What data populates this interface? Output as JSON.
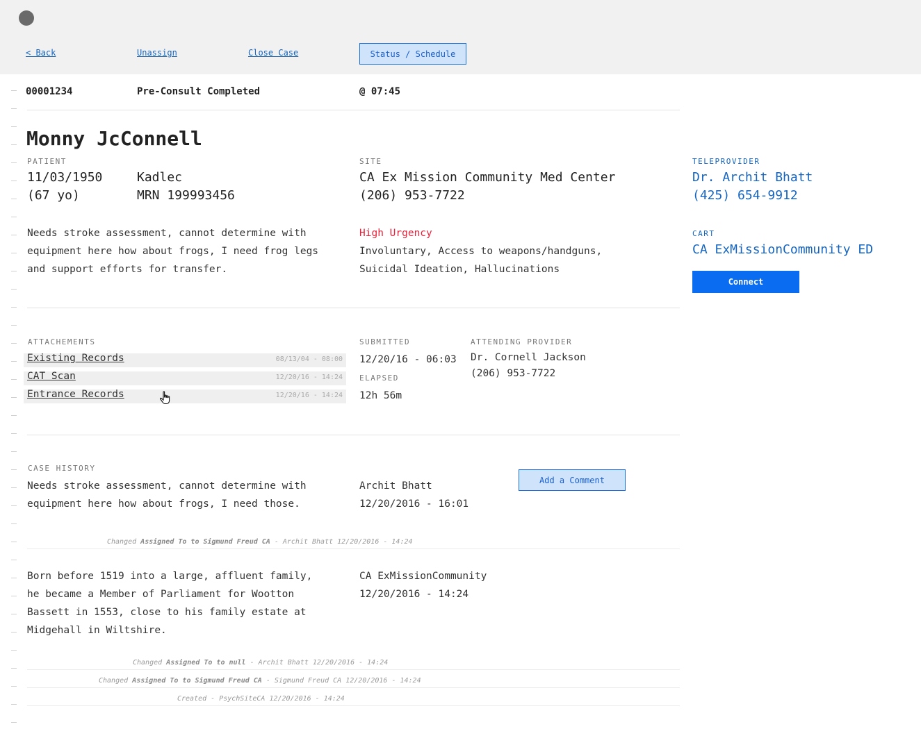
{
  "nav": {
    "back": "< Back",
    "unassign": "Unassign",
    "close_case": "Close Case",
    "status_schedule": "Status / Schedule"
  },
  "case": {
    "id": "00001234",
    "status": "Pre-Consult Completed",
    "time": "@ 07:45"
  },
  "patient": {
    "name": "Monny JcConnell",
    "label": "PATIENT",
    "dob": "11/03/1950",
    "age": "(67 yo)",
    "facility": "Kadlec",
    "mrn": "MRN 199993456",
    "note": "Needs stroke assessment, cannot determine with equipment here how about frogs, I need frog legs and support efforts for transfer."
  },
  "site": {
    "label": "SITE",
    "name": "CA Ex Mission Community Med Center",
    "phone": "(206) 953-7722",
    "urgency": "High Urgency",
    "urgency_color": "#e8223a",
    "flags": "Involuntary, Access to weapons/handguns, Suicidal Ideation, Hallucinations"
  },
  "teleprovider": {
    "label": "TELEPROVIDER",
    "name": "Dr. Archit Bhatt",
    "phone": "(425) 654-9912"
  },
  "cart": {
    "label": "CART",
    "name": "CA ExMissionCommunity ED",
    "connect": "Connect"
  },
  "attachments": {
    "label": "ATTACHEMENTS",
    "items": [
      {
        "name": "Existing Records",
        "date": "08/13/04 - 08:00"
      },
      {
        "name": "CAT Scan",
        "date": "12/20/16 - 14:24"
      },
      {
        "name": "Entrance Records",
        "date": "12/20/16 - 14:24"
      }
    ]
  },
  "submitted": {
    "label": "SUBMITTED",
    "value": "12/20/16 - 06:03",
    "elapsed_label": "ELAPSED",
    "elapsed": "12h 56m"
  },
  "attending": {
    "label": "ATTENDING PROVIDER",
    "name": "Dr. Cornell Jackson",
    "phone": "(206) 953-7722"
  },
  "history": {
    "label": "CASE HISTORY",
    "add_comment": "Add a Comment",
    "comments": [
      {
        "text": "Needs stroke assessment, cannot determine with equipment here how about frogs, I need those.",
        "author": "Archit Bhatt",
        "time": "12/20/2016 - 16:01"
      },
      {
        "text": "Born before 1519 into a large, affluent family, he became a Member of Parliament for Wootton Bassett in 1553, close to his family estate at Midgehall in Wiltshire.",
        "author": "CA ExMissionCommunity",
        "time": "12/20/2016 - 14:24"
      }
    ],
    "changes": [
      {
        "prefix": "Changed ",
        "field": "Assigned To to Sigmund Freud CA",
        "suffix": " - Archit Bhatt 12/20/2016 - 14:24"
      },
      {
        "prefix": "Changed ",
        "field": "Assigned To to null",
        "suffix": " - Archit Bhatt 12/20/2016 - 14:24"
      },
      {
        "prefix": "Changed ",
        "field": "Assigned To to Sigmund Freud CA",
        "suffix": " - Sigmund Freud CA 12/20/2016 - 14:24"
      },
      {
        "prefix": "",
        "field": "",
        "suffix": "Created - PsychSiteCA 12/20/2016 - 14:24"
      }
    ]
  }
}
